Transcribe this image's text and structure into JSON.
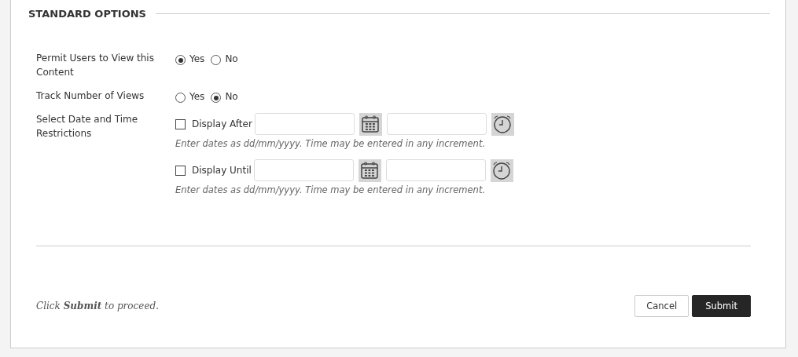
{
  "section_title": "STANDARD OPTIONS",
  "radio_rows": [
    {
      "label": "Permit Users to View this Content",
      "options": [
        {
          "label": "Yes",
          "selected": true
        },
        {
          "label": "No",
          "selected": false
        }
      ]
    },
    {
      "label": "Track Number of Views",
      "options": [
        {
          "label": "Yes",
          "selected": false
        },
        {
          "label": "No",
          "selected": true
        }
      ]
    }
  ],
  "date_restrictions": {
    "label": "Select Date and Time Restrictions",
    "items": [
      {
        "label": "Display After",
        "checked": false,
        "hint": "Enter dates as dd/mm/yyyy. Time may be entered in any increment."
      },
      {
        "label": "Display Until",
        "checked": false,
        "hint": "Enter dates as dd/mm/yyyy. Time may be entered in any increment."
      }
    ]
  },
  "footer_note": "Click **Submit** to proceed.",
  "buttons": [
    {
      "label": "Cancel",
      "kind": "secondary"
    },
    {
      "label": "Submit",
      "kind": "primary"
    }
  ]
}
